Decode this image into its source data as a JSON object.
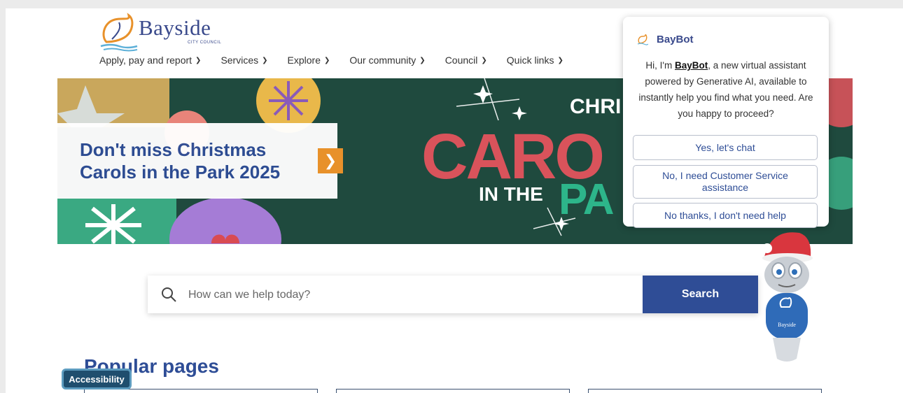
{
  "header": {
    "logo_text": "Bayside",
    "logo_sub": "CITY COUNCIL",
    "nav": [
      {
        "label": "Apply, pay and report"
      },
      {
        "label": "Services"
      },
      {
        "label": "Explore"
      },
      {
        "label": "Our community"
      },
      {
        "label": "Council"
      },
      {
        "label": "Quick links"
      }
    ]
  },
  "banner": {
    "title": "Don't miss Christmas Carols in the Park 2025",
    "art_chri": "CHRI",
    "art_carols": "CARO",
    "art_inthe": "IN THE",
    "art_pa": "PA"
  },
  "search": {
    "placeholder": "How can we help today?",
    "button": "Search"
  },
  "popular": {
    "title": "Popular pages"
  },
  "accessibility": {
    "label": "Accessibility"
  },
  "baybot": {
    "name": "BayBot",
    "msg_prefix": "Hi, I'm ",
    "msg_name": "BayBot",
    "msg_rest": ", a new virtual assistant powered by Generative AI, available to instantly help you find what you need. Are you happy to proceed?",
    "options": [
      {
        "label": "Yes, let's chat"
      },
      {
        "label": "No, I need Customer Service assistance"
      },
      {
        "label": "No thanks, I don't need help"
      }
    ],
    "mascot_text": "Bayside"
  },
  "colors": {
    "brand_blue": "#2e4d96",
    "banner_green": "#1f4a3e",
    "accent_orange": "#e8912a"
  }
}
